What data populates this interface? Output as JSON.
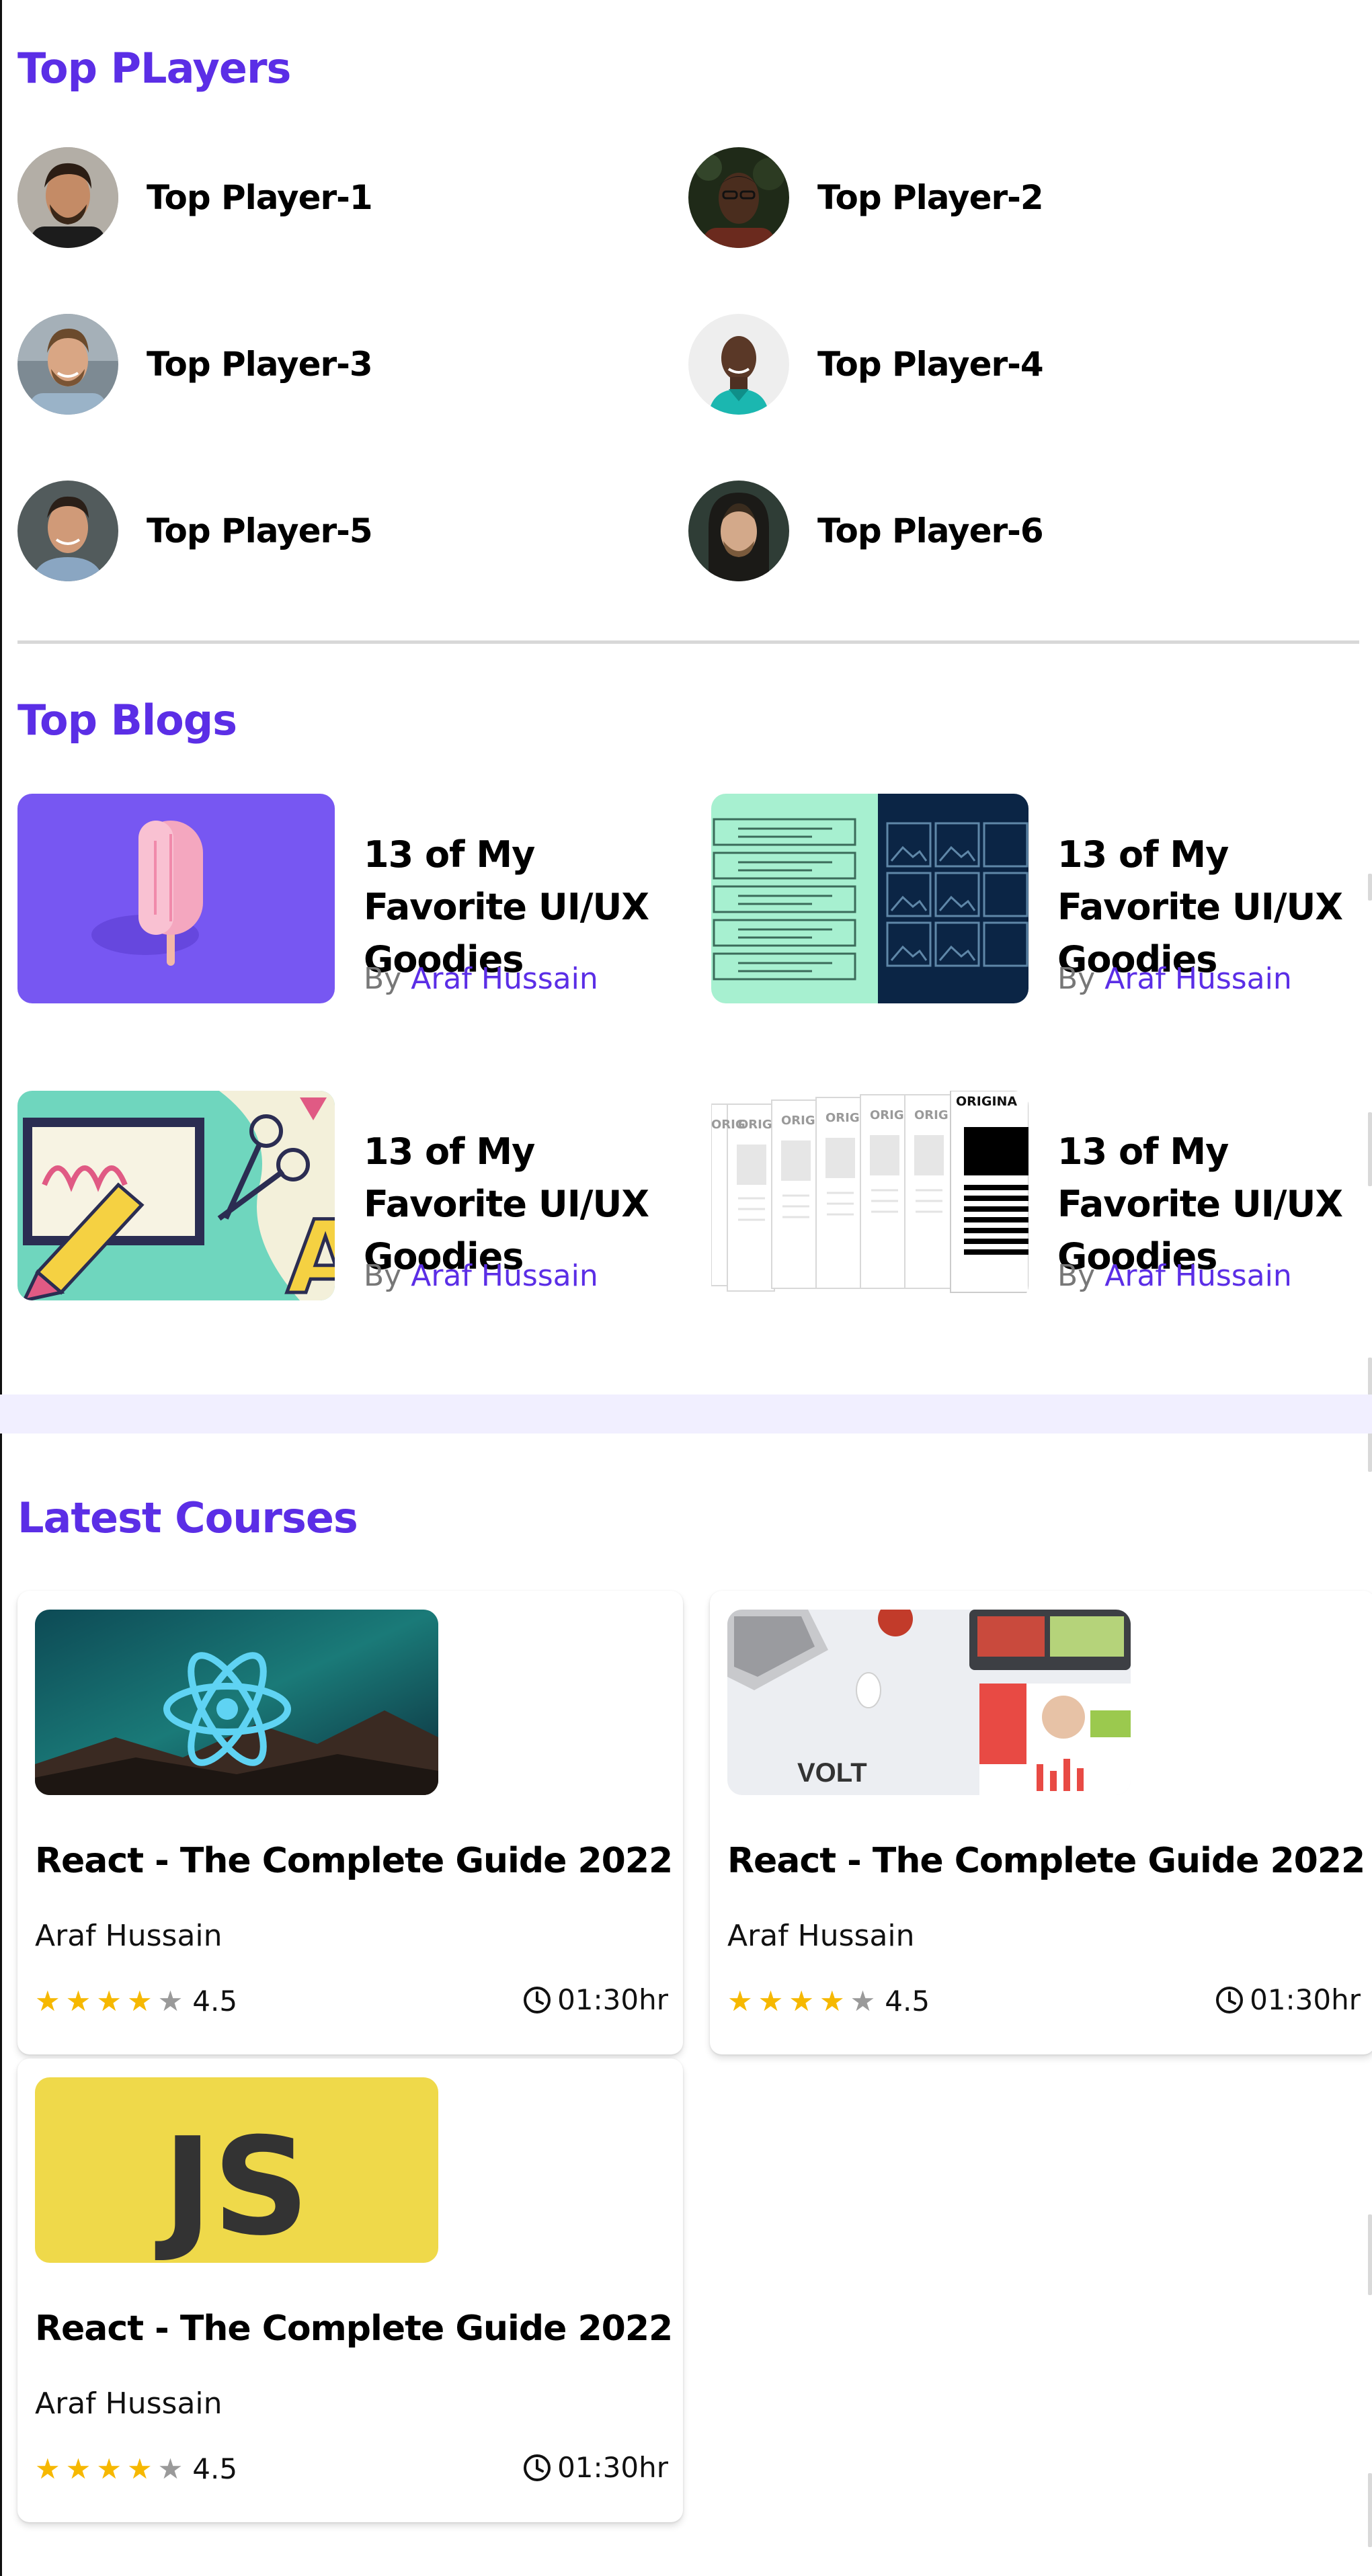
{
  "top_players": {
    "title": "Top PLayers",
    "items": [
      {
        "name": "Top Player-1"
      },
      {
        "name": "Top Player-2"
      },
      {
        "name": "Top Player-3"
      },
      {
        "name": "Top Player-4"
      },
      {
        "name": "Top Player-5"
      },
      {
        "name": "Top Player-6"
      }
    ]
  },
  "top_blogs": {
    "title": "Top Blogs",
    "items": [
      {
        "title": "13 of My Favorite UI/UX Goodies",
        "by": "By",
        "author": "Araf Hussain"
      },
      {
        "title": "13 of My Favorite UI/UX Goodies",
        "by": "By",
        "author": "Araf Hussain"
      },
      {
        "title": "13 of My Favorite UI/UX Goodies",
        "by": "By",
        "author": "Araf Hussain"
      },
      {
        "title": "13 of My Favorite UI/UX Goodies",
        "by": "By",
        "author": "Araf Hussain"
      }
    ],
    "thumb_text": {
      "volt": "VOLT",
      "js": "JS",
      "original": "ORIGINA",
      "orig": "ORIG"
    }
  },
  "latest_courses": {
    "title": "Latest Courses",
    "items": [
      {
        "title": "React - The Complete Guide 2022",
        "author": "Araf Hussain",
        "rating": "4.5",
        "stars": 4,
        "duration": "01:30hr"
      },
      {
        "title": "React - The Complete Guide 2022",
        "author": "Araf Hussain",
        "rating": "4.5",
        "stars": 4,
        "duration": "01:30hr"
      },
      {
        "title": "React - The Complete Guide 2022",
        "author": "Araf Hussain",
        "rating": "4.5",
        "stars": 4,
        "duration": "01:30hr"
      }
    ]
  },
  "colors": {
    "accent": "#5b2ee6",
    "star": "#f6b800",
    "band": "#f1efff"
  }
}
